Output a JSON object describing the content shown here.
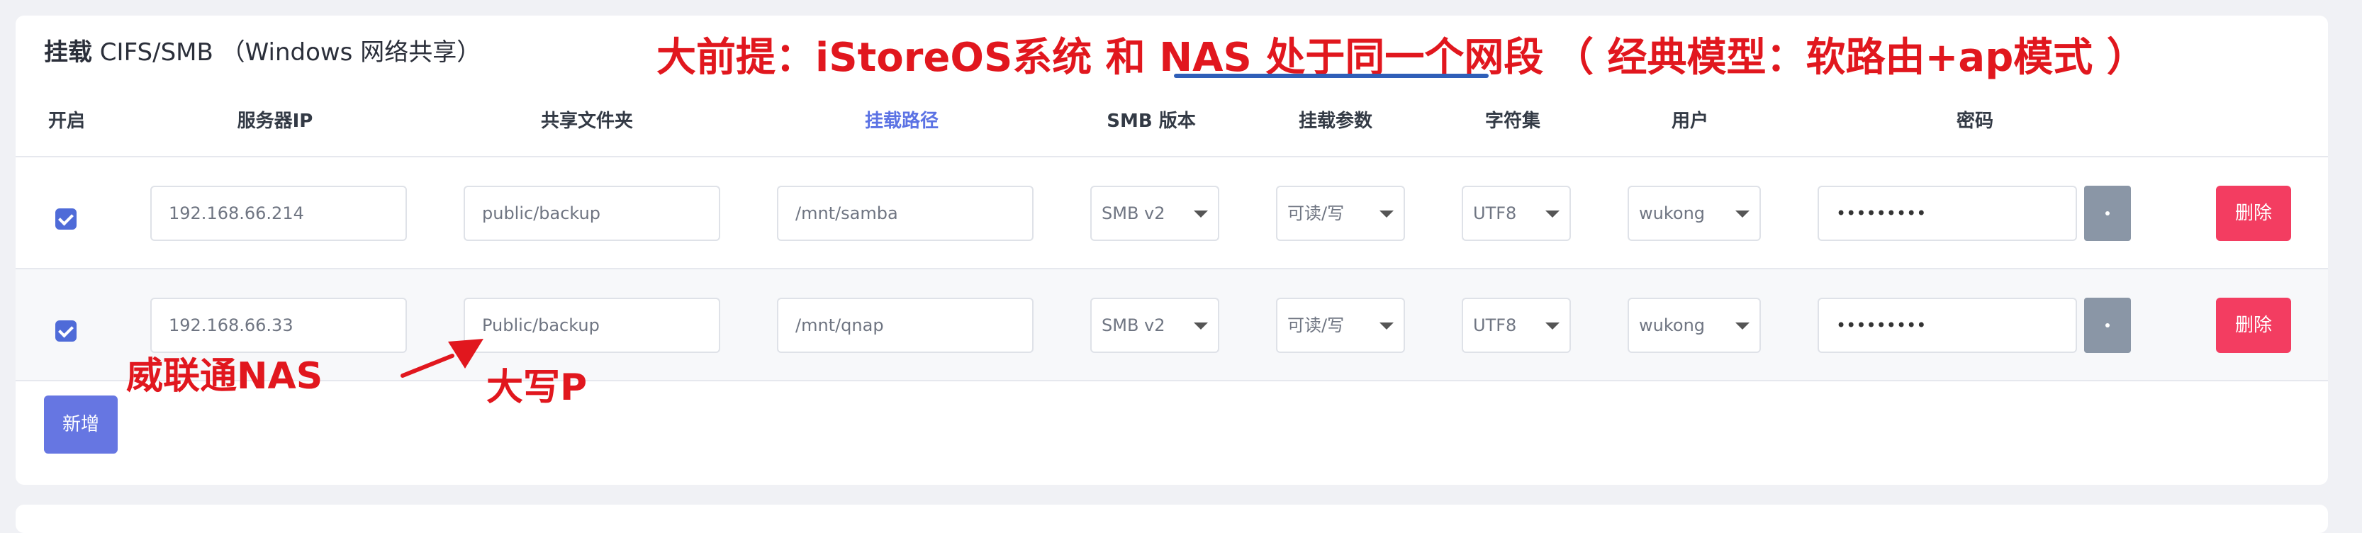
{
  "panel": {
    "title_main": "挂载",
    "title_rest": " CIFS/SMB （Windows 网络共享）"
  },
  "table": {
    "columns": {
      "enabled": "开启",
      "server_ip": "服务器IP",
      "share_folder": "共享文件夹",
      "mount_path": "挂载路径",
      "smb_version": "SMB 版本",
      "mount_params": "挂载参数",
      "charset": "字符集",
      "user": "用户",
      "password": "密码"
    },
    "rows": [
      {
        "enabled": true,
        "server_ip": "192.168.66.214",
        "share_folder": "public/backup",
        "mount_path": "/mnt/samba",
        "smb_version": "SMB v2",
        "mount_params": "可读/写",
        "charset": "UTF8",
        "user": "wukong",
        "password": "•••••••••",
        "delete_label": "删除"
      },
      {
        "enabled": true,
        "server_ip": "192.168.66.33",
        "share_folder": "Public/backup",
        "mount_path": "/mnt/qnap",
        "smb_version": "SMB v2",
        "mount_params": "可读/写",
        "charset": "UTF8",
        "user": "wukong",
        "password": "•••••••••",
        "delete_label": "删除"
      }
    ]
  },
  "add_button": "新增",
  "annotations": {
    "premise": "大前提：iStoreOS系统 和 NAS 处于同一个网段",
    "model": "（ 经典模型：软路由+ap模式 ）",
    "qnap": "威联通NAS",
    "uppercase_p": "大写P"
  },
  "icons": {
    "checkbox": "check-icon",
    "caret": "chevron-down-icon",
    "eye": "eye-icon",
    "arrow": "arrow-icon"
  },
  "colors": {
    "primary": "#5b72e4",
    "danger": "#f33d61",
    "annotation": "#e1171e",
    "underline": "#2f5fb8"
  }
}
